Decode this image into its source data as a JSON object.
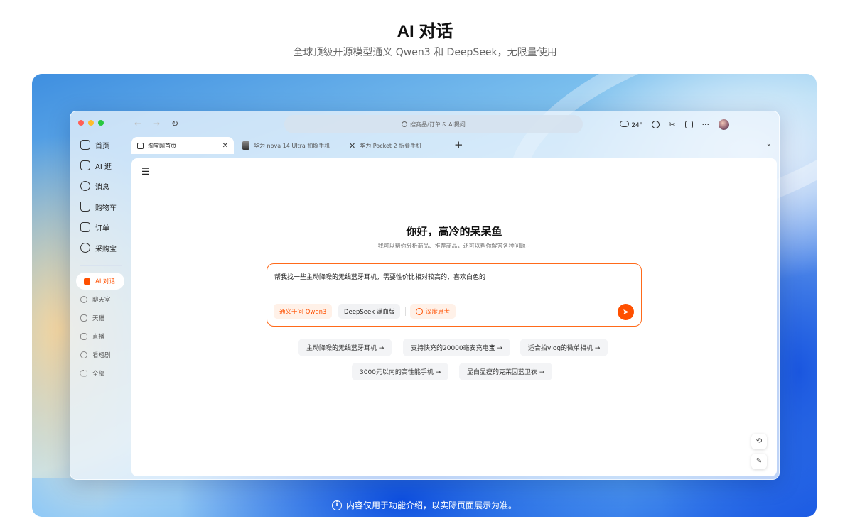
{
  "hero": {
    "title": "AI 对话",
    "subtitle": "全球顶级开源模型通义 Qwen3 和 DeepSeek，无限量使用"
  },
  "notice": "内容仅用于功能介绍，以实际页面展示为准。",
  "browser": {
    "address_placeholder": "搜商品/订单 & AI提问",
    "weather": "24°",
    "tabs": [
      {
        "label": "淘宝网首页"
      },
      {
        "label": "华为 nova 14 Ultra 拍照手机"
      },
      {
        "label": "华为 Pocket 2 折叠手机"
      }
    ]
  },
  "sidebar": {
    "items": [
      {
        "label": "首页",
        "icon": "home-icon"
      },
      {
        "label": "AI 逛",
        "icon": "camera-bag-icon"
      },
      {
        "label": "消息",
        "icon": "chat-bubble-icon"
      },
      {
        "label": "购物车",
        "icon": "cart-icon"
      },
      {
        "label": "订单",
        "icon": "clipboard-icon"
      },
      {
        "label": "采购宝",
        "icon": "refresh-badge-icon"
      }
    ],
    "sub_items": [
      {
        "label": "AI 对话",
        "icon": "ai-chat-icon"
      },
      {
        "label": "聊天室",
        "icon": "hash-icon"
      },
      {
        "label": "天猫",
        "icon": "tmall-icon"
      },
      {
        "label": "直播",
        "icon": "live-icon"
      },
      {
        "label": "看短剧",
        "icon": "play-icon"
      },
      {
        "label": "全部",
        "icon": "grid-icon"
      }
    ]
  },
  "chat": {
    "greeting": "你好，高冷的呆呆鱼",
    "greeting_sub": "我可以帮你分析商品、推荐商品，还可以帮你解答各种问题~",
    "input_value": "帮我找一些主动降噪的无线蓝牙耳机，需要性价比相对较高的，喜欢白色的",
    "chips": {
      "qwen": "通义千问 Qwen3",
      "deepseek": "DeepSeek 满血版",
      "deep_think": "深度思考"
    },
    "suggestions": [
      "主动降噪的无线蓝牙耳机 →",
      "支持快充的20000毫安充电宝 →",
      "适合拍vlog的微单相机 →",
      "3000元以内的高性能手机 →",
      "显白显瘦的克莱因蓝卫衣 →"
    ]
  },
  "colors": {
    "accent": "#ff5000",
    "input_border": "#ff6a1a"
  }
}
